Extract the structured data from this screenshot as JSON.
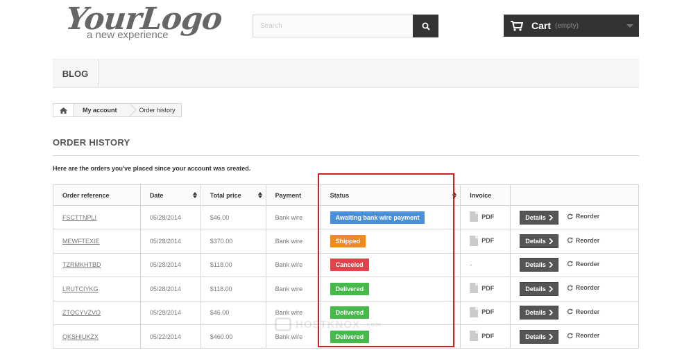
{
  "logo": {
    "main": "YourLogo",
    "tagline": "a new experience"
  },
  "search": {
    "placeholder": "Search"
  },
  "cart": {
    "label": "Cart",
    "status": "(empty)"
  },
  "menu": {
    "items": [
      "BLOG"
    ]
  },
  "breadcrumb": {
    "parent": "My account",
    "current": "Order history"
  },
  "page": {
    "title": "ORDER HISTORY",
    "intro": "Here are the orders you've placed since your account was created."
  },
  "table": {
    "headers": {
      "reference": "Order reference",
      "date": "Date",
      "price": "Total price",
      "payment": "Payment",
      "status": "Status",
      "invoice": "Invoice"
    },
    "rows": [
      {
        "reference": "FSCTTNPLI",
        "date": "05/28/2014",
        "price": "$46.00",
        "payment": "Bank wire",
        "status": "Awaiting bank wire payment",
        "status_color": "#4a90d9",
        "invoice": "PDF",
        "details": "Details",
        "reorder": "Reorder"
      },
      {
        "reference": "MEWFTEXIE",
        "date": "05/28/2014",
        "price": "$370.00",
        "payment": "Bank wire",
        "status": "Shipped",
        "status_color": "#ef8a21",
        "invoice": "PDF",
        "details": "Details",
        "reorder": "Reorder"
      },
      {
        "reference": "TZRMKHTBD",
        "date": "05/28/2014",
        "price": "$118.00",
        "payment": "Bank wire",
        "status": "Canceled",
        "status_color": "#e2434b",
        "invoice": "-",
        "details": "Details",
        "reorder": "Reorder"
      },
      {
        "reference": "LRUTCIYKG",
        "date": "05/28/2014",
        "price": "$118.00",
        "payment": "Bank wire",
        "status": "Delivered",
        "status_color": "#46b94a",
        "invoice": "PDF",
        "details": "Details",
        "reorder": "Reorder"
      },
      {
        "reference": "ZTQCYVZVO",
        "date": "05/28/2014",
        "price": "$46.00",
        "payment": "Bank wire",
        "status": "Delivered",
        "status_color": "#46b94a",
        "invoice": "PDF",
        "details": "Details",
        "reorder": "Reorder"
      },
      {
        "reference": "QKSHIUKZX",
        "date": "05/22/2014",
        "price": "$460.00",
        "payment": "Bank wire",
        "status": "Delivered",
        "status_color": "#46b94a",
        "invoice": "PDF",
        "details": "Details",
        "reorder": "Reorder"
      }
    ]
  },
  "watermark": {
    "text": "HOSTKNOX",
    "suffix": ".com"
  },
  "icons": {
    "search": "search-icon",
    "cart": "cart-icon",
    "home": "home-icon",
    "pdf": "file-icon",
    "details": "chevron-right-icon",
    "reorder": "refresh-icon"
  },
  "colors": {
    "highlight": "#cc1f1f",
    "dark": "#333333"
  }
}
